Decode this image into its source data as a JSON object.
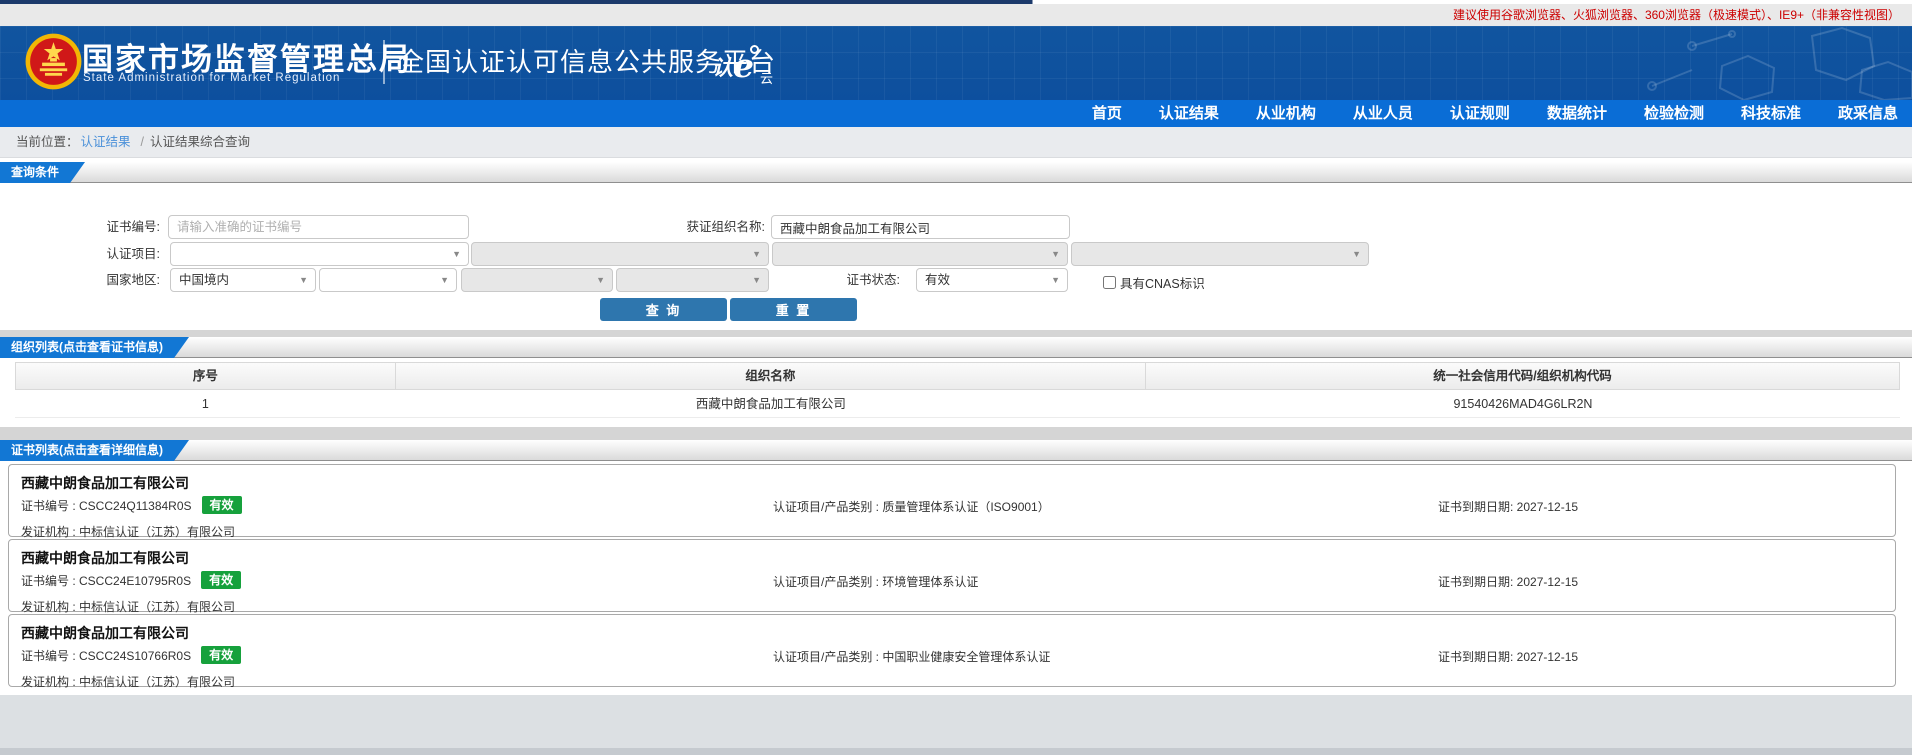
{
  "colors": {
    "accent_blue": "#1277d4",
    "status_green": "#16a13c",
    "notice_red": "#cc0000"
  },
  "top_bar": {
    "browser_notice": "建议使用谷歌浏览器、火狐浏览器、360浏览器（极速模式）、IE9+（非兼容性视图）"
  },
  "header": {
    "org_name_cn": "国家市场监督管理总局",
    "org_name_en": "State Administration  for  Market Regulation",
    "platform_title": "全国认证认可信息公共服务平台",
    "logo": {
      "ren": "认",
      "e": "e",
      "yun": "云"
    }
  },
  "nav": {
    "items": [
      "首页",
      "认证结果",
      "从业机构",
      "从业人员",
      "认证规则",
      "数据统计",
      "检验检测",
      "科技标准",
      "政采信息"
    ]
  },
  "breadcrumb": {
    "prefix": "当前位置：",
    "link": "认证结果",
    "separator": "/",
    "current": "认证结果综合查询"
  },
  "query_section": {
    "tab_label": "查询条件",
    "fields": {
      "cert_no_label": "证书编号:",
      "cert_no_placeholder": "请输入准确的证书编号",
      "org_name_label": "获证组织名称:",
      "org_name_value": "西藏中朗食品加工有限公司",
      "cert_project_label": "认证项目:",
      "region_label": "国家地区:",
      "region_value": "中国境内",
      "cert_status_label": "证书状态:",
      "cert_status_value": "有效",
      "cnas_label": "具有CNAS标识"
    },
    "buttons": {
      "search": "查 询",
      "reset": "重 置"
    }
  },
  "org_section": {
    "tab_label": "组织列表(点击查看证书信息)",
    "table": {
      "headers": [
        "序号",
        "组织名称",
        "统一社会信用代码/组织机构代码"
      ],
      "rows": [
        [
          "1",
          "西藏中朗食品加工有限公司",
          "91540426MAD4G6LR2N"
        ]
      ]
    }
  },
  "cert_section": {
    "tab_label": "证书列表(点击查看详细信息)",
    "labels": {
      "cert_no": "证书编号 : ",
      "project": "认证项目/产品类别 : ",
      "expiry": "证书到期日期: ",
      "issuer": "发证机构 : "
    },
    "cards": [
      {
        "org": "西藏中朗食品加工有限公司",
        "cert_no": "CSCC24Q11384R0S",
        "status": "有效",
        "project": "质量管理体系认证（ISO9001）",
        "expiry": "2027-12-15",
        "issuer": "中标信认证（江苏）有限公司"
      },
      {
        "org": "西藏中朗食品加工有限公司",
        "cert_no": "CSCC24E10795R0S",
        "status": "有效",
        "project": "环境管理体系认证",
        "expiry": "2027-12-15",
        "issuer": "中标信认证（江苏）有限公司"
      },
      {
        "org": "西藏中朗食品加工有限公司",
        "cert_no": "CSCC24S10766R0S",
        "status": "有效",
        "project": "中国职业健康安全管理体系认证",
        "expiry": "2027-12-15",
        "issuer": "中标信认证（江苏）有限公司"
      }
    ]
  }
}
